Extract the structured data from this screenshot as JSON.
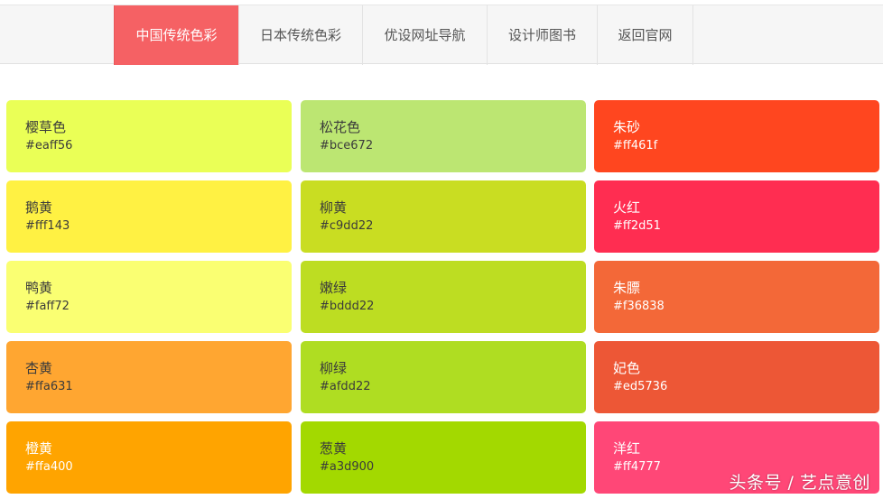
{
  "nav": {
    "items": [
      {
        "label": "中国传统色彩",
        "active": true
      },
      {
        "label": "日本传统色彩",
        "active": false
      },
      {
        "label": "优设网址导航",
        "active": false
      },
      {
        "label": "设计师图书",
        "active": false
      },
      {
        "label": "返回官网",
        "active": false
      }
    ],
    "accent_color": "#f56164"
  },
  "colors": {
    "col1": [
      {
        "name": "樱草色",
        "hex": "#eaff56"
      },
      {
        "name": "鹅黄",
        "hex": "#fff143"
      },
      {
        "name": "鸭黄",
        "hex": "#faff72"
      },
      {
        "name": "杏黄",
        "hex": "#ffa631"
      },
      {
        "name": "橙黄",
        "hex": "#ffa400"
      }
    ],
    "col2": [
      {
        "name": "松花色",
        "hex": "#bce672"
      },
      {
        "name": "柳黄",
        "hex": "#c9dd22"
      },
      {
        "name": "嫩绿",
        "hex": "#bddd22"
      },
      {
        "name": "柳绿",
        "hex": "#afdd22"
      },
      {
        "name": "葱黄",
        "hex": "#a3d900"
      }
    ],
    "col3": [
      {
        "name": "朱砂",
        "hex": "#ff461f"
      },
      {
        "name": "火红",
        "hex": "#ff2d51"
      },
      {
        "name": "朱膘",
        "hex": "#f36838"
      },
      {
        "name": "妃色",
        "hex": "#ed5736"
      },
      {
        "name": "洋红",
        "hex": "#ff4777"
      }
    ]
  },
  "watermark": "头条号 / 艺点意创"
}
